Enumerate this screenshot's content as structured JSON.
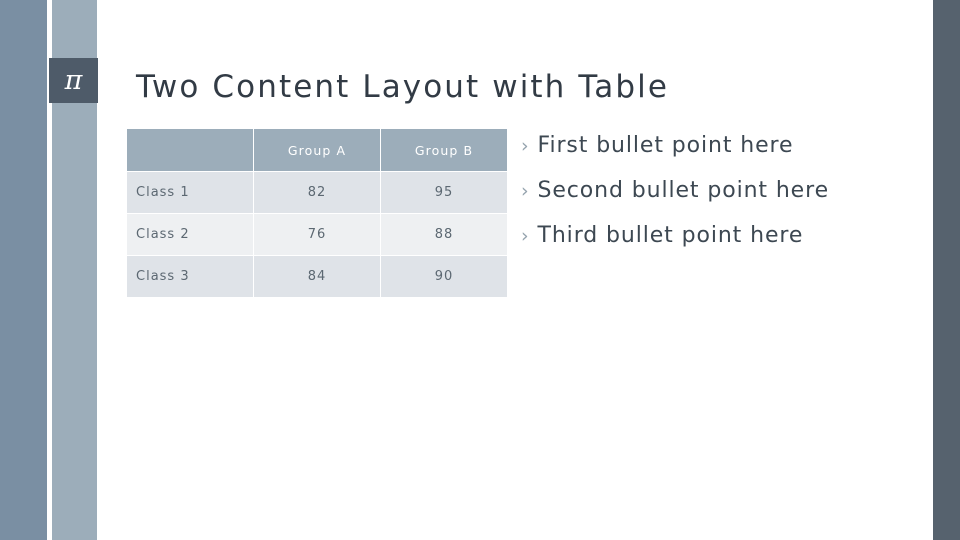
{
  "slide": {
    "title": "Two Content Layout with Table",
    "logo_glyph": "π",
    "colors": {
      "bar_dark_left": "#7a8fa3",
      "bar_light_left": "#9cadba",
      "bar_dark_right": "#56626e",
      "logo_tile": "#4e5b69",
      "title_text": "#323b45",
      "table_header_bg": "#9cadba",
      "table_row_band_a": "#dfe3e8",
      "table_row_band_b": "#eef0f2",
      "table_text": "#5c6872",
      "bullet_text": "#3d4852",
      "bullet_marker": "#95a3ae"
    }
  },
  "table": {
    "headers": [
      "",
      "Group A",
      "Group B"
    ],
    "rows": [
      {
        "label": "Class 1",
        "group_a": "82",
        "group_b": "95"
      },
      {
        "label": "Class 2",
        "group_a": "76",
        "group_b": "88"
      },
      {
        "label": "Class 3",
        "group_a": "84",
        "group_b": "90"
      }
    ]
  },
  "bullets": {
    "marker": "›",
    "items": [
      "First bullet point here",
      "Second bullet point here",
      "Third bullet point here"
    ]
  }
}
